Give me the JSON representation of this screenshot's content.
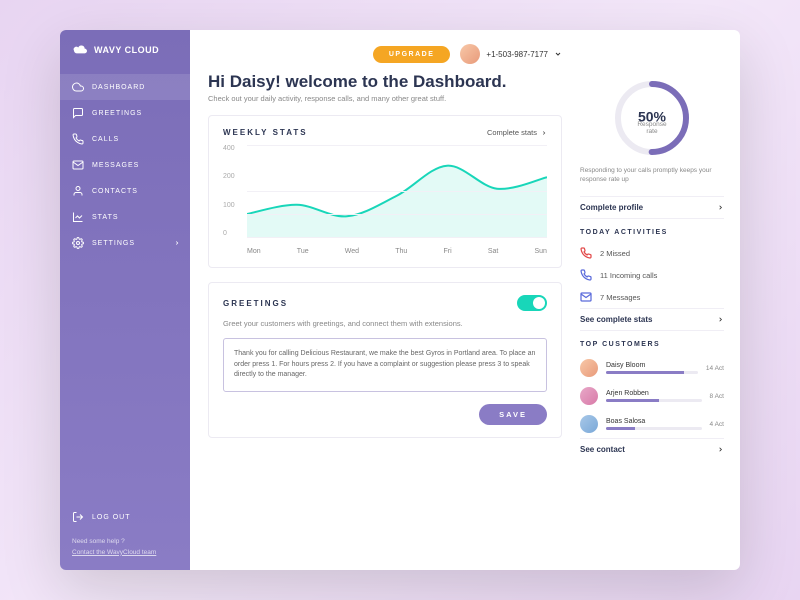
{
  "brand": "WAVY CLOUD",
  "sidebar": {
    "items": [
      {
        "label": "DASHBOARD",
        "icon": "cloud-icon",
        "active": true
      },
      {
        "label": "GREETINGS",
        "icon": "chat-icon"
      },
      {
        "label": "CALLS",
        "icon": "phone-icon"
      },
      {
        "label": "MESSAGES",
        "icon": "mail-icon"
      },
      {
        "label": "CONTACTS",
        "icon": "user-icon"
      },
      {
        "label": "STATS",
        "icon": "stats-icon"
      },
      {
        "label": "SETTINGS",
        "icon": "gear-icon",
        "chevron": true
      }
    ],
    "logout": "LOG OUT",
    "help1": "Need some help ?",
    "help2": "Contact the WavyCloud team"
  },
  "topbar": {
    "upgrade": "UPGRADE",
    "phone": "+1-503-987-7177"
  },
  "header": {
    "title": "Hi Daisy! welcome to the Dashboard.",
    "subtitle": "Check out your daily activity, response calls, and many other great stuff."
  },
  "stats_card": {
    "title": "WEEKLY STATS",
    "link": "Complete stats"
  },
  "chart_data": {
    "type": "line",
    "categories": [
      "Mon",
      "Tue",
      "Wed",
      "Thu",
      "Fri",
      "Sat",
      "Sun"
    ],
    "values": [
      100,
      140,
      90,
      180,
      310,
      210,
      260
    ],
    "ylabels": [
      "400",
      "200",
      "100",
      "0"
    ],
    "ylim": [
      0,
      400
    ],
    "title": "WEEKLY STATS",
    "xlabel": "",
    "ylabel": ""
  },
  "greetings_card": {
    "title": "GREETINGS",
    "desc": "Greet your customers with greetings, and connect them with extensions.",
    "text": "Thank you for calling Delicious Restaurant, we make the best Gyros in Portland area. To place an order press 1. For hours press 2. If you have a complaint or suggestion please press 3 to speak directly to the manager.",
    "save": "SAVE",
    "toggle_on": true
  },
  "gauge": {
    "pct": "50%",
    "label": "Response rate",
    "note": "Responding to your calls promptly keeps your response rate up",
    "link": "Complete profile"
  },
  "activities": {
    "title": "TODAY ACTIVITIES",
    "items": [
      {
        "text": "2 Missed",
        "color": "#e24a4a",
        "type": "missed"
      },
      {
        "text": "11 Incoming calls",
        "color": "#5b6bdb",
        "type": "incoming"
      },
      {
        "text": "7 Messages",
        "color": "#5b6bdb",
        "type": "message"
      }
    ],
    "link": "See complete stats"
  },
  "customers": {
    "title": "TOP CUSTOMERS",
    "items": [
      {
        "name": "Daisy Bloom",
        "val": "14 Act",
        "pct": 85,
        "color": "linear-gradient(135deg,#f8c8a8,#e89a7a)"
      },
      {
        "name": "Arjen Robben",
        "val": "8 Act",
        "pct": 55,
        "color": "linear-gradient(135deg,#e8a8c8,#d87aa8)"
      },
      {
        "name": "Boas Salosa",
        "val": "4 Act",
        "pct": 30,
        "color": "linear-gradient(135deg,#a8c8e8,#7aa8d8)"
      }
    ],
    "link": "See contact"
  }
}
